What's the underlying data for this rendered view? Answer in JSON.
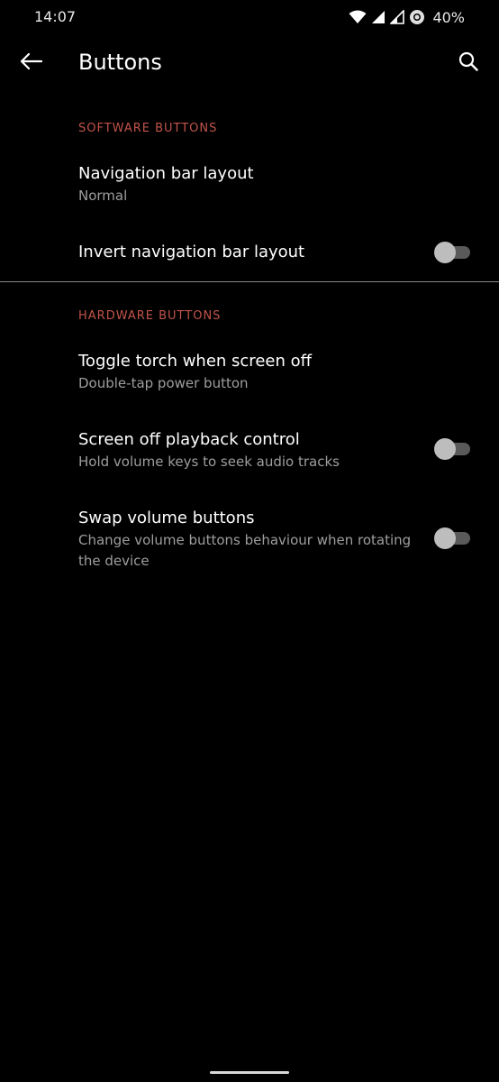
{
  "status_bar": {
    "time": "14:07",
    "battery": "40%",
    "icons": [
      "wifi-icon",
      "cell-signal-icon",
      "cell-signal-2-icon",
      "data-saver-icon"
    ]
  },
  "app_bar": {
    "title": "Buttons",
    "back_icon": "arrow-back-icon",
    "search_icon": "search-icon"
  },
  "sections": {
    "software": {
      "header": "SOFTWARE BUTTONS",
      "items": [
        {
          "title": "Navigation bar layout",
          "summary": "Normal"
        },
        {
          "title": "Invert navigation bar layout",
          "toggle": false
        }
      ]
    },
    "hardware": {
      "header": "HARDWARE BUTTONS",
      "items": [
        {
          "title": "Toggle torch when screen off",
          "summary": "Double-tap power button"
        },
        {
          "title": "Screen off playback control",
          "summary": "Hold volume keys to seek audio tracks",
          "toggle": false
        },
        {
          "title": "Swap volume buttons",
          "summary": "Change volume buttons behaviour when rotating the device",
          "toggle": false
        }
      ]
    }
  },
  "colors": {
    "background": "#000000",
    "accent": "#c2544a",
    "primary_text": "#ffffff",
    "secondary_text": "#9e9e9e"
  }
}
